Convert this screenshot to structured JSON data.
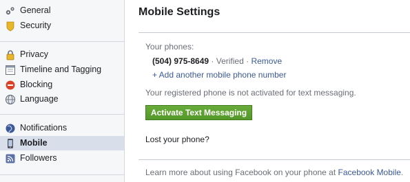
{
  "sidebar": {
    "items": [
      {
        "label": "General",
        "icon": "gears-icon"
      },
      {
        "label": "Security",
        "icon": "shield-icon"
      },
      {
        "label": "Privacy",
        "icon": "lock-icon"
      },
      {
        "label": "Timeline and Tagging",
        "icon": "timeline-icon"
      },
      {
        "label": "Blocking",
        "icon": "block-icon"
      },
      {
        "label": "Language",
        "icon": "globe-icon"
      },
      {
        "label": "Notifications",
        "icon": "globe-notifications-icon"
      },
      {
        "label": "Mobile",
        "icon": "mobile-phone-icon",
        "selected": true
      },
      {
        "label": "Followers",
        "icon": "rss-icon"
      }
    ]
  },
  "main": {
    "title": "Mobile Settings",
    "phones_label": "Your phones:",
    "phone": {
      "number": "(504) 975-8649",
      "separator": "·",
      "status": "Verified",
      "remove_label": "Remove"
    },
    "add_phone_label": "+ Add another mobile phone number",
    "notice": "Your registered phone is not activated for text messaging.",
    "activate_button": "Activate Text Messaging",
    "lost_phone_label": "Lost your phone?",
    "footer": {
      "text": "Learn more about using Facebook on your phone at ",
      "link": "Facebook Mobile",
      "period": "."
    }
  },
  "colors": {
    "link": "#3b5998",
    "button_green": "#5fa232",
    "selected_bg": "#d8dfea"
  }
}
